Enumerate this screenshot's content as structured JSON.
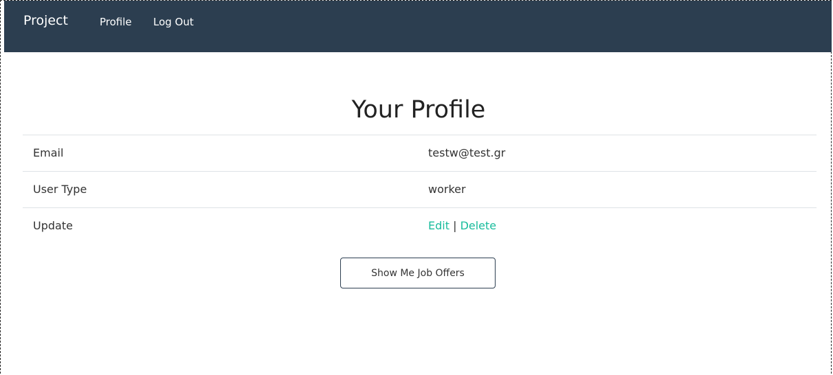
{
  "navbar": {
    "brand": "Project",
    "links": [
      "Profile",
      "Log Out"
    ],
    "background": "#2c3e50"
  },
  "main": {
    "title": "Your Profile",
    "rows": [
      {
        "label": "Email",
        "value": "testw@test.gr"
      },
      {
        "label": "User Type",
        "value": "worker"
      },
      {
        "label": "Update",
        "edit": "Edit",
        "separator": "|",
        "delete": "Delete"
      }
    ],
    "button_label": "Show Me Job Offers",
    "link_color": "#18bc9c"
  }
}
